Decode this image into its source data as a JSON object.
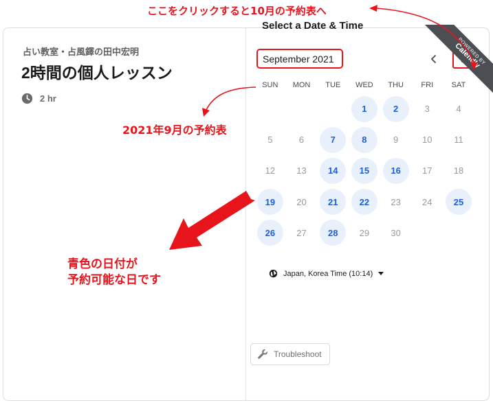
{
  "event": {
    "organizer": "占い教室・占風鐸の田中宏明",
    "title": "2時間の個人レッスン",
    "duration": "2 hr"
  },
  "troubleshoot": {
    "label": "Troubleshoot"
  },
  "calendar": {
    "heading": "Select a Date & Time",
    "month": "September 2021",
    "weekdays": [
      "SUN",
      "MON",
      "TUE",
      "WED",
      "THU",
      "FRI",
      "SAT"
    ],
    "timezone": "Japan, Korea Time (10:14)",
    "accent_color": "#1c5fd6",
    "available_bg": "#e8f0fc"
  },
  "ribbon": {
    "line1": "POWERED BY",
    "line2": "Calendly"
  },
  "annotations": {
    "top": "ここをクリックすると10月の予約表へ",
    "middle": "2021年9月の予約表",
    "bottom_line1": "青色の日付が",
    "bottom_line2": "予約可能な日です",
    "color": "#e8141c"
  }
}
